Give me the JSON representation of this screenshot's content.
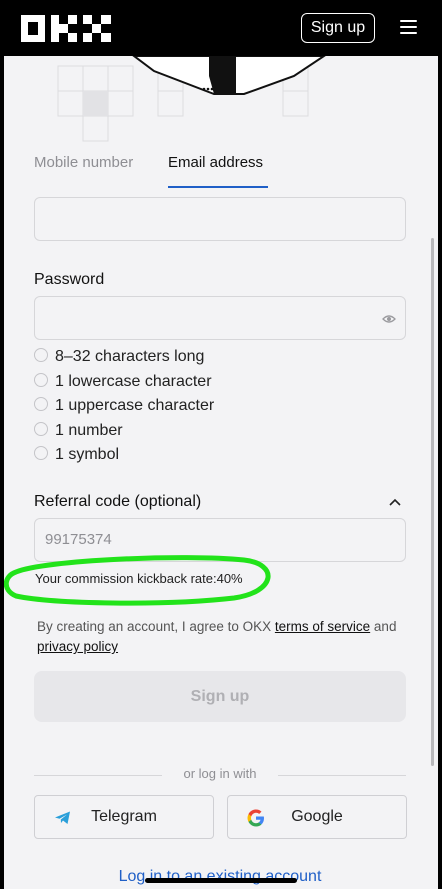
{
  "header": {
    "signup_label": "Sign up"
  },
  "tabs": {
    "mobile": "Mobile number",
    "email": "Email address"
  },
  "email_input": {
    "value": ""
  },
  "password": {
    "label": "Password",
    "value": ""
  },
  "requirements": [
    "8–32 characters long",
    "1 lowercase character",
    "1 uppercase character",
    "1 number",
    "1 symbol"
  ],
  "referral": {
    "label": "Referral code (optional)",
    "value": "99175374"
  },
  "kickback_text": "Your commission kickback rate:40%",
  "terms": {
    "prefix": "By creating an account, I agree to OKX ",
    "tos": "terms of service",
    "and": " and",
    "privacy": "privacy policy"
  },
  "signup_button": "Sign up",
  "or_login": "or log in with",
  "social": {
    "telegram": "Telegram",
    "google": "Google"
  },
  "login_existing": "Log in to an existing account",
  "colors": {
    "accent": "#1f5fc7",
    "highlight": "#22e31a",
    "telegram": "#2a9fd9"
  }
}
